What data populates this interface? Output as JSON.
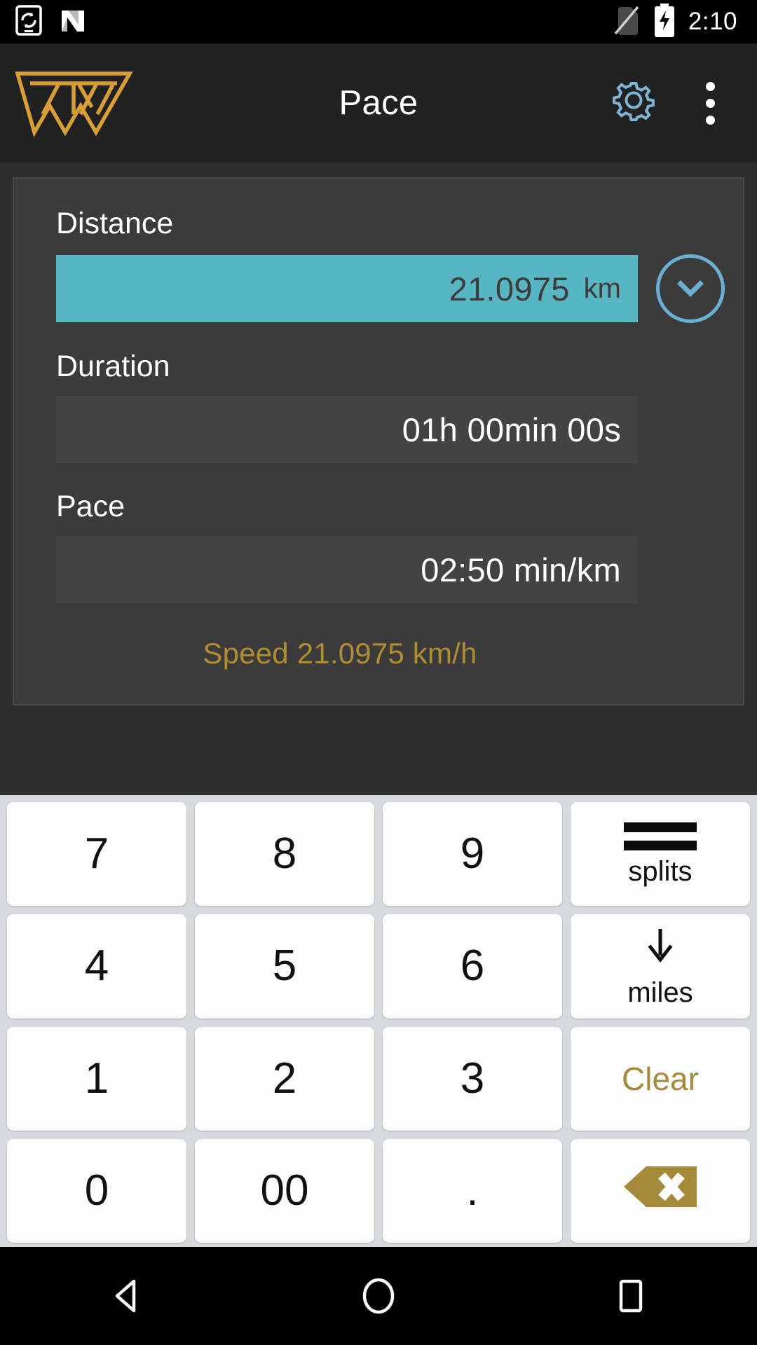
{
  "statusbar": {
    "time": "2:10",
    "icons": [
      {
        "name": "screen-rotation-sync-icon"
      },
      {
        "name": "nfc-n-icon"
      },
      {
        "name": "no-sim-icon"
      },
      {
        "name": "battery-charging-icon"
      }
    ]
  },
  "appbar": {
    "title": "Pace",
    "logo_name": "tw-triangle-logo",
    "logo_color": "#d79f36",
    "settings_label": "Settings",
    "settings_color": "#7fb4d4",
    "overflow_label": "More options"
  },
  "card": {
    "distance": {
      "label": "Distance",
      "value": "21.0975",
      "unit": "km",
      "highlight_color": "#57b6c2",
      "dropdown_label": "Select preset distance"
    },
    "duration": {
      "label": "Duration",
      "value": "01h 00min 00s"
    },
    "pace": {
      "label": "Pace",
      "value": "02:50 min/km"
    },
    "speed": {
      "text": "Speed 21.0975 km/h",
      "color": "#b08c33"
    }
  },
  "keypad": {
    "keys": [
      {
        "label": "7",
        "name": "key-7",
        "type": "digit"
      },
      {
        "label": "8",
        "name": "key-8",
        "type": "digit"
      },
      {
        "label": "9",
        "name": "key-9",
        "type": "digit"
      },
      {
        "label": "splits",
        "name": "key-splits",
        "type": "icon-label",
        "icon": "equals-bars-icon"
      },
      {
        "label": "4",
        "name": "key-4",
        "type": "digit"
      },
      {
        "label": "5",
        "name": "key-5",
        "type": "digit"
      },
      {
        "label": "6",
        "name": "key-6",
        "type": "digit"
      },
      {
        "label": "miles",
        "name": "key-miles",
        "type": "icon-label",
        "icon": "arrow-down-icon"
      },
      {
        "label": "1",
        "name": "key-1",
        "type": "digit"
      },
      {
        "label": "2",
        "name": "key-2",
        "type": "digit"
      },
      {
        "label": "3",
        "name": "key-3",
        "type": "digit"
      },
      {
        "label": "Clear",
        "name": "key-clear",
        "type": "gold-text"
      },
      {
        "label": "0",
        "name": "key-0",
        "type": "digit"
      },
      {
        "label": "00",
        "name": "key-double-zero",
        "type": "digit"
      },
      {
        "label": ".",
        "name": "key-decimal",
        "type": "dot"
      },
      {
        "label": "",
        "name": "key-backspace",
        "type": "backspace",
        "icon": "backspace-icon",
        "color": "#a58a3c"
      }
    ]
  },
  "navbar": {
    "back_label": "Back",
    "home_label": "Home",
    "recents_label": "Recents"
  }
}
